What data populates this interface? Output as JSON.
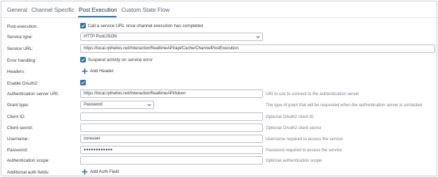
{
  "tabs": [
    "General",
    "Channel Specific",
    "Post Execution",
    "Custom State Flow"
  ],
  "active_tab": "Post Execution",
  "fields": {
    "post_execution": {
      "label": "Post-execution:",
      "checkbox_text": "Call a service URL once channel execution has completed",
      "checked": true
    },
    "service_type": {
      "label": "Service type:",
      "value": "HTTP Post/JSON"
    },
    "service_url": {
      "label": "Service URL:",
      "value": "https://local.rpihelios.net/InteractionRealtimeAPI/api/Cache/ChannelPostExecution"
    },
    "error_handling": {
      "label": "Error handling:",
      "checkbox_text": "Suspend activity on service error",
      "checked": true
    },
    "headers": {
      "label": "Headers:",
      "button": "Add Header"
    },
    "enable_oauth2": {
      "label": "Enable OAuth2:",
      "checked": true
    },
    "auth_server_url": {
      "label": "Authentication server URI:",
      "value": "https://local.rpihelios.net/InteractionRealtimeAPI/token",
      "hint": "URI to use to connect to the authentication server"
    },
    "grant_type": {
      "label": "Grant type:",
      "value": "Password",
      "hint": "The type of grant that will be requested when the authentication server is contacted"
    },
    "client_id": {
      "label": "Client ID:",
      "value": "",
      "hint": "Optional OAuth2 client ID"
    },
    "client_secret": {
      "label": "Client secret:",
      "value": "",
      "hint": "Optional OAuth2 client secret"
    },
    "username": {
      "label": "Username:",
      "value": "coreuser",
      "hint": "Username required to access the service"
    },
    "password": {
      "label": "Password:",
      "value": "●●●●●●●●●●●●",
      "hint": "Password required to access the service"
    },
    "auth_scope": {
      "label": "Authentication scope:",
      "value": "",
      "hint": "Optional authentication scope"
    },
    "additional_auth": {
      "label": "Additional auth fields:",
      "button": "Add Auth Field"
    }
  },
  "colors": {
    "accent": "#2f6fa6",
    "border": "#b9bec5",
    "hint": "#7a7f86"
  },
  "icons": {
    "checkbox": "check-icon",
    "add": "plus-icon",
    "dropdown": "chevron-down-icon"
  }
}
